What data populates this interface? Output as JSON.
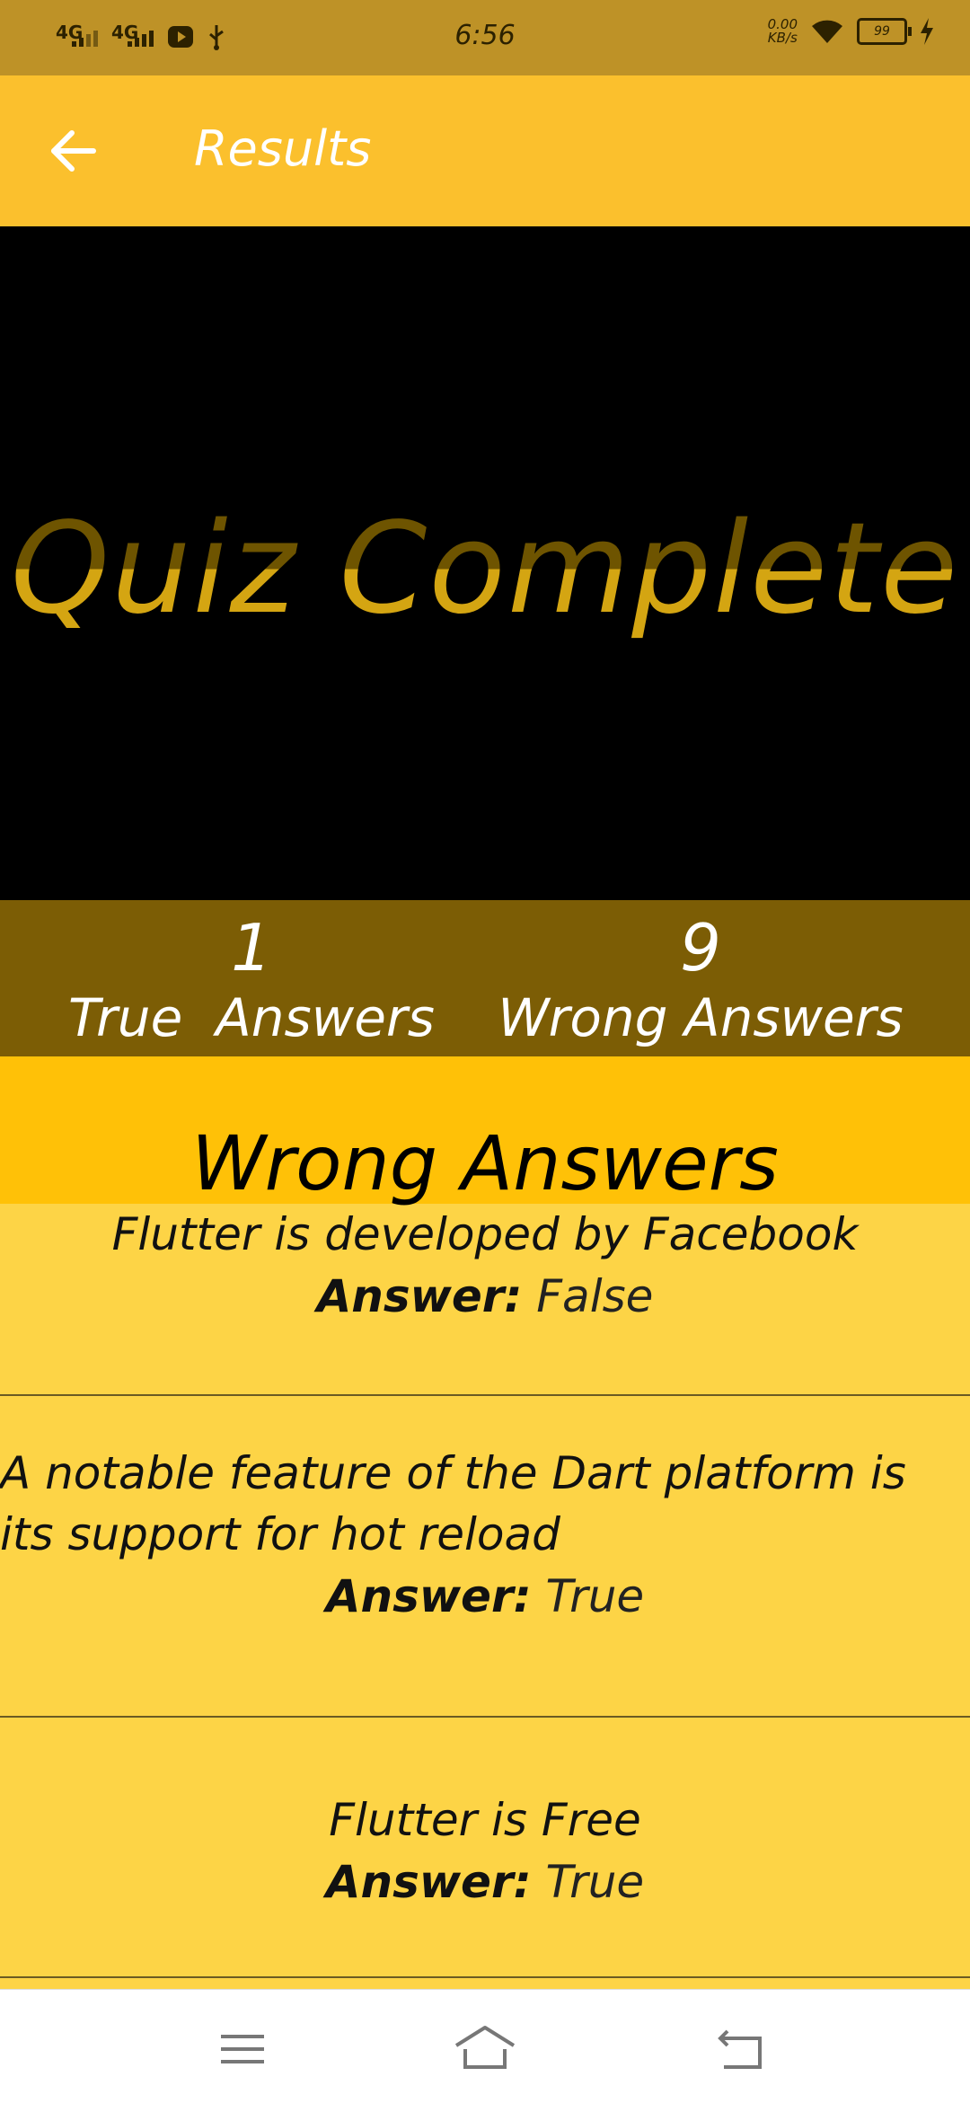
{
  "status_bar": {
    "net1": "4G",
    "net2": "4G",
    "time": "6:56",
    "speed_value": "0.00",
    "speed_unit": "KB/s",
    "battery": "99"
  },
  "app_bar": {
    "title": "Results"
  },
  "hero": {
    "title": "Quiz Complete"
  },
  "scores": {
    "true_count": "1",
    "true_label": "True  Answers",
    "wrong_count": "9",
    "wrong_label": "Wrong Answers"
  },
  "wrong_section": {
    "title": "Wrong Answers"
  },
  "answer_label": "Answer:",
  "wrong_items": [
    {
      "question": "Flutter is developed by Facebook",
      "answer": "False"
    },
    {
      "question": "A notable feature of the Dart platform is its support for hot reload",
      "answer": "True"
    },
    {
      "question": "Flutter is Free",
      "answer": "True"
    }
  ],
  "colors": {
    "status_bar": "#BE9227",
    "app_bar": "#FBC02D",
    "hero_bg": "#000000",
    "hero_text": "#D4A512",
    "scores_bg": "#7C5D05",
    "section_header": "#FFC107",
    "list_bg": "#FDD446"
  },
  "icons": {
    "back": "arrow-left-icon",
    "menu": "menu-icon",
    "home": "home-icon",
    "return": "back-nav-icon"
  }
}
